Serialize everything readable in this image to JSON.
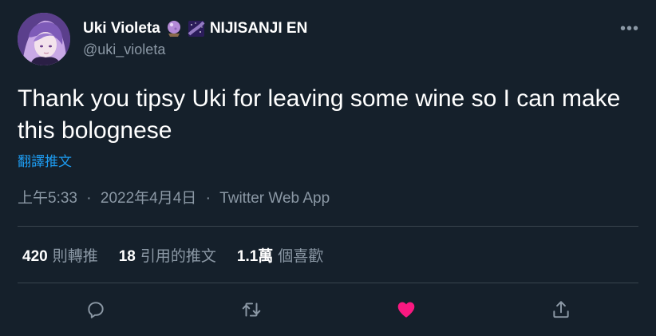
{
  "user": {
    "display_name": "Uki Violeta",
    "org_name": "NIJISANJI EN",
    "handle": "@uki_violeta",
    "badge_icons": [
      "crystal-ball-icon",
      "milky-way-icon"
    ]
  },
  "menu": {
    "more_glyph": "•••"
  },
  "tweet": {
    "text": "Thank you tipsy Uki for leaving some wine so I can make this bolognese",
    "translate_label": "翻譯推文"
  },
  "meta": {
    "time": "上午5:33",
    "separator": "·",
    "date": "2022年4月4日",
    "source": "Twitter Web App"
  },
  "stats": {
    "retweets": {
      "count": "420",
      "label": "則轉推"
    },
    "quotes": {
      "count": "18",
      "label": "引用的推文"
    },
    "likes": {
      "count": "1.1萬",
      "label": "個喜歡"
    }
  },
  "actions": [
    {
      "icon": "reply-icon"
    },
    {
      "icon": "retweet-icon"
    },
    {
      "icon": "like-icon",
      "active": true
    },
    {
      "icon": "share-icon"
    }
  ],
  "colors": {
    "background": "#15202b",
    "text_primary": "#ffffff",
    "text_secondary": "#8b98a5",
    "link": "#1d9bf0",
    "like": "#f91880",
    "divider": "#38444d"
  }
}
